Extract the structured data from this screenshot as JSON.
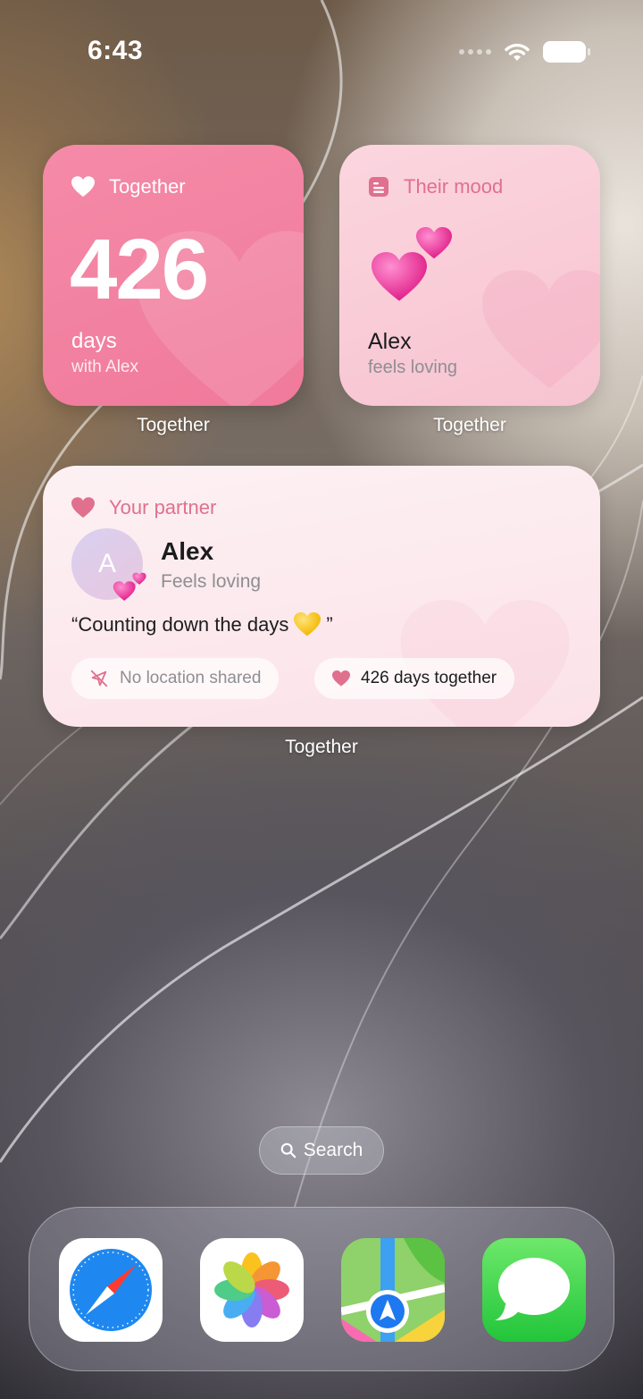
{
  "status_bar": {
    "time": "6:43"
  },
  "widgets": {
    "together": {
      "header": "Together",
      "count": "426",
      "unit": "days",
      "subtitle": "with Alex",
      "caption": "Together"
    },
    "mood": {
      "header": "Their mood",
      "name": "Alex",
      "status": "feels loving",
      "caption": "Together"
    },
    "partner": {
      "header": "Your partner",
      "avatar_initial": "A",
      "name": "Alex",
      "status": "Feels loving",
      "quote": "“Counting down the days",
      "quote_end": "”",
      "location_chip": "No location shared",
      "days_chip": "426 days together",
      "caption": "Together"
    }
  },
  "search": {
    "label": "Search"
  },
  "dock": {
    "apps": [
      "Safari",
      "Photos",
      "Maps",
      "Messages"
    ]
  },
  "colors": {
    "widget_pink": "#f07a9b",
    "accent_pink": "#e0708e"
  }
}
